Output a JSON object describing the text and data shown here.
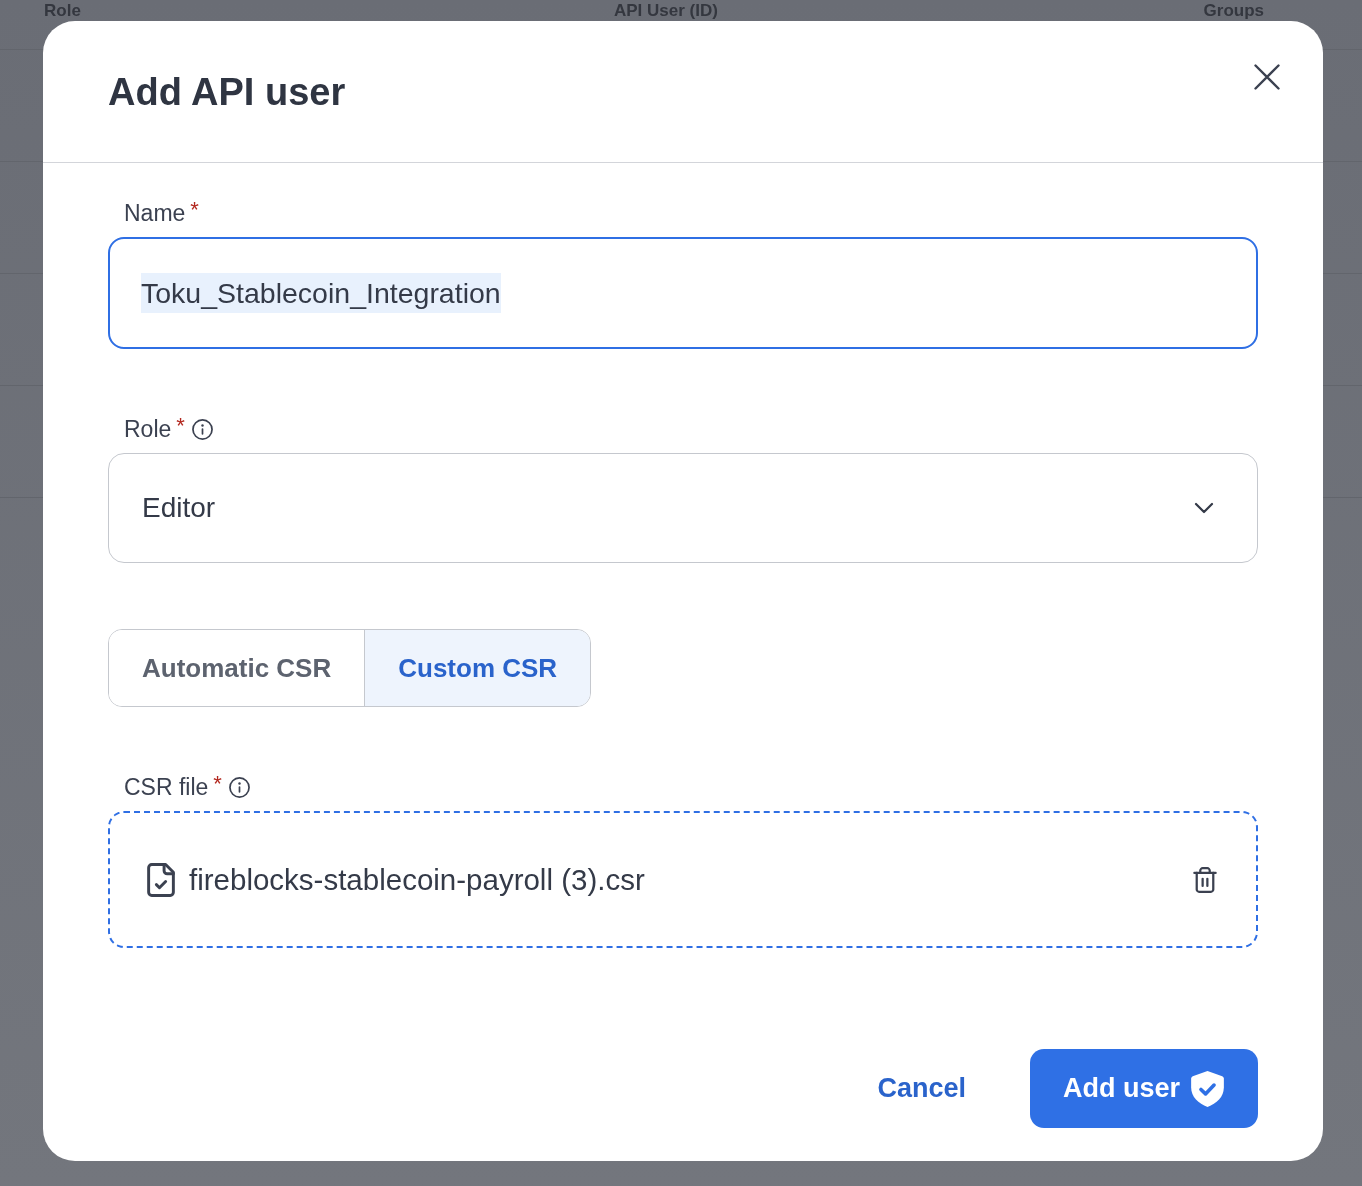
{
  "background_table": {
    "columns": [
      "Role",
      "API User (ID)",
      "Groups"
    ]
  },
  "dialog": {
    "title": "Add API user",
    "form": [
      {
        "kind": "text",
        "label": "Name",
        "required_mark": "*",
        "value": "Toku_Stablecoin_Integration",
        "focused": true,
        "text_selected": true
      },
      {
        "kind": "select",
        "label": "Role",
        "required_mark": "*",
        "info": true,
        "value": "Editor",
        "focused": false
      },
      {
        "kind": "segmented",
        "options": [
          {
            "label": "Automatic CSR",
            "selected": false
          },
          {
            "label": "Custom CSR",
            "selected": true
          }
        ]
      },
      {
        "kind": "file",
        "label": "CSR file",
        "required_mark": "*",
        "info": true,
        "file_name": "fireblocks-stablecoin-payroll (3).csr"
      }
    ],
    "buttons": [
      {
        "kind": "link",
        "label": "Cancel"
      },
      {
        "kind": "primary",
        "label": "Add user"
      }
    ]
  }
}
